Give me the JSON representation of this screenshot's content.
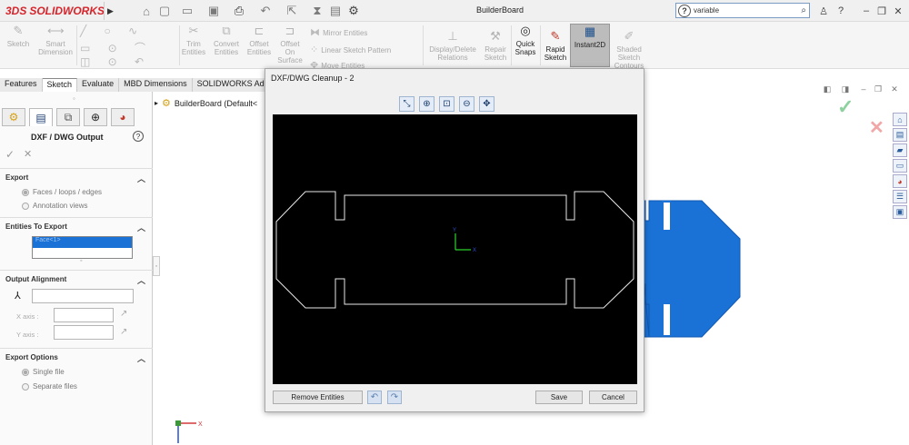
{
  "app": {
    "brand": "SOLIDWORKS",
    "brand_prefix": "3DS",
    "title": "BuilderBoard",
    "search_value": "variable",
    "colors": {
      "brand_red": "#d6242b",
      "part_blue": "#1e6fd6",
      "selection_blue": "#1a72d6"
    }
  },
  "toolbar_icons": [
    "home-icon",
    "new-document-icon",
    "open-icon",
    "save-icon",
    "print-icon",
    "undo-icon",
    "select-icon",
    "rebuild-icon",
    "options-icon"
  ],
  "command_manager": {
    "buttons": [
      {
        "label": "Sketch"
      },
      {
        "label": "Smart\nDimension"
      },
      {
        "label": "Trim\nEntities"
      },
      {
        "label": "Convert\nEntities"
      },
      {
        "label": "Offset\nEntities"
      },
      {
        "label": "Offset\nOn\nSurface"
      },
      {
        "label": "Mirror Entities"
      },
      {
        "label": "Linear Sketch Pattern"
      },
      {
        "label": "Move Entities"
      },
      {
        "label": "Display/Delete\nRelations"
      },
      {
        "label": "Repair\nSketch"
      },
      {
        "label": "Quick\nSnaps"
      },
      {
        "label": "Rapid\nSketch"
      },
      {
        "label": "Instant2D"
      },
      {
        "label": "Shaded\nSketch\nContours"
      }
    ]
  },
  "tabs": [
    "Features",
    "Sketch",
    "Evaluate",
    "MBD Dimensions",
    "SOLIDWORKS Add-I"
  ],
  "property_manager": {
    "title": "DXF / DWG Output",
    "sections": {
      "export": {
        "title": "Export",
        "options": [
          "Faces / loops / edges",
          "Annotation views"
        ]
      },
      "entities": {
        "title": "Entities To Export",
        "selected": "Face<1>"
      },
      "alignment": {
        "title": "Output Alignment",
        "x_label": "X axis :",
        "y_label": "Y axis :"
      },
      "options": {
        "title": "Export Options",
        "options": [
          "Single file",
          "Separate files"
        ]
      }
    }
  },
  "tree": {
    "root": "BuilderBoard  (Default<"
  },
  "dialog": {
    "title": "DXF/DWG Cleanup - 2",
    "buttons": {
      "remove": "Remove Entities",
      "save": "Save",
      "cancel": "Cancel"
    },
    "axis_labels": {
      "x": "X",
      "y": "Y"
    }
  },
  "triad": {
    "x": "X",
    "y": "Y"
  }
}
